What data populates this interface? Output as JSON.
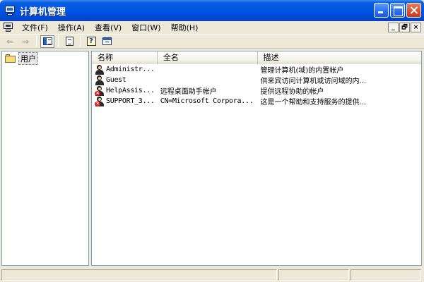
{
  "window": {
    "title": "计算机管理",
    "icon": "computer-management-icon"
  },
  "menu": {
    "items": [
      "文件(F)",
      "操作(A)",
      "查看(V)",
      "窗口(W)",
      "帮助(H)"
    ],
    "mdi_buttons": [
      "_",
      "🗗",
      "×"
    ]
  },
  "toolbar": {
    "buttons": [
      "back-arrow-icon",
      "forward-arrow-icon",
      "show-hide-tree-icon",
      "export-list-icon",
      "help-icon",
      "properties-icon"
    ],
    "back": "⇐",
    "forward": "⇒",
    "help": "?"
  },
  "tree": {
    "selected_node": "用户"
  },
  "list": {
    "columns": [
      "名称",
      "全名",
      "描述"
    ],
    "rows": [
      {
        "name": "Administr...",
        "fullname": "",
        "description": "管理计算机(域)的内置帐户",
        "disabled": false
      },
      {
        "name": "Guest",
        "fullname": "",
        "description": "供来宾访问计算机或访问域的内...",
        "disabled": false
      },
      {
        "name": "HelpAssis...",
        "fullname": "远程桌面助手帐户",
        "description": "提供远程协助的帐户",
        "disabled": true
      },
      {
        "name": "SUPPORT_3...",
        "fullname": "CN=Microsoft Corpora...",
        "description": "这是一个帮助和支持服务的提供...",
        "disabled": true
      }
    ]
  }
}
